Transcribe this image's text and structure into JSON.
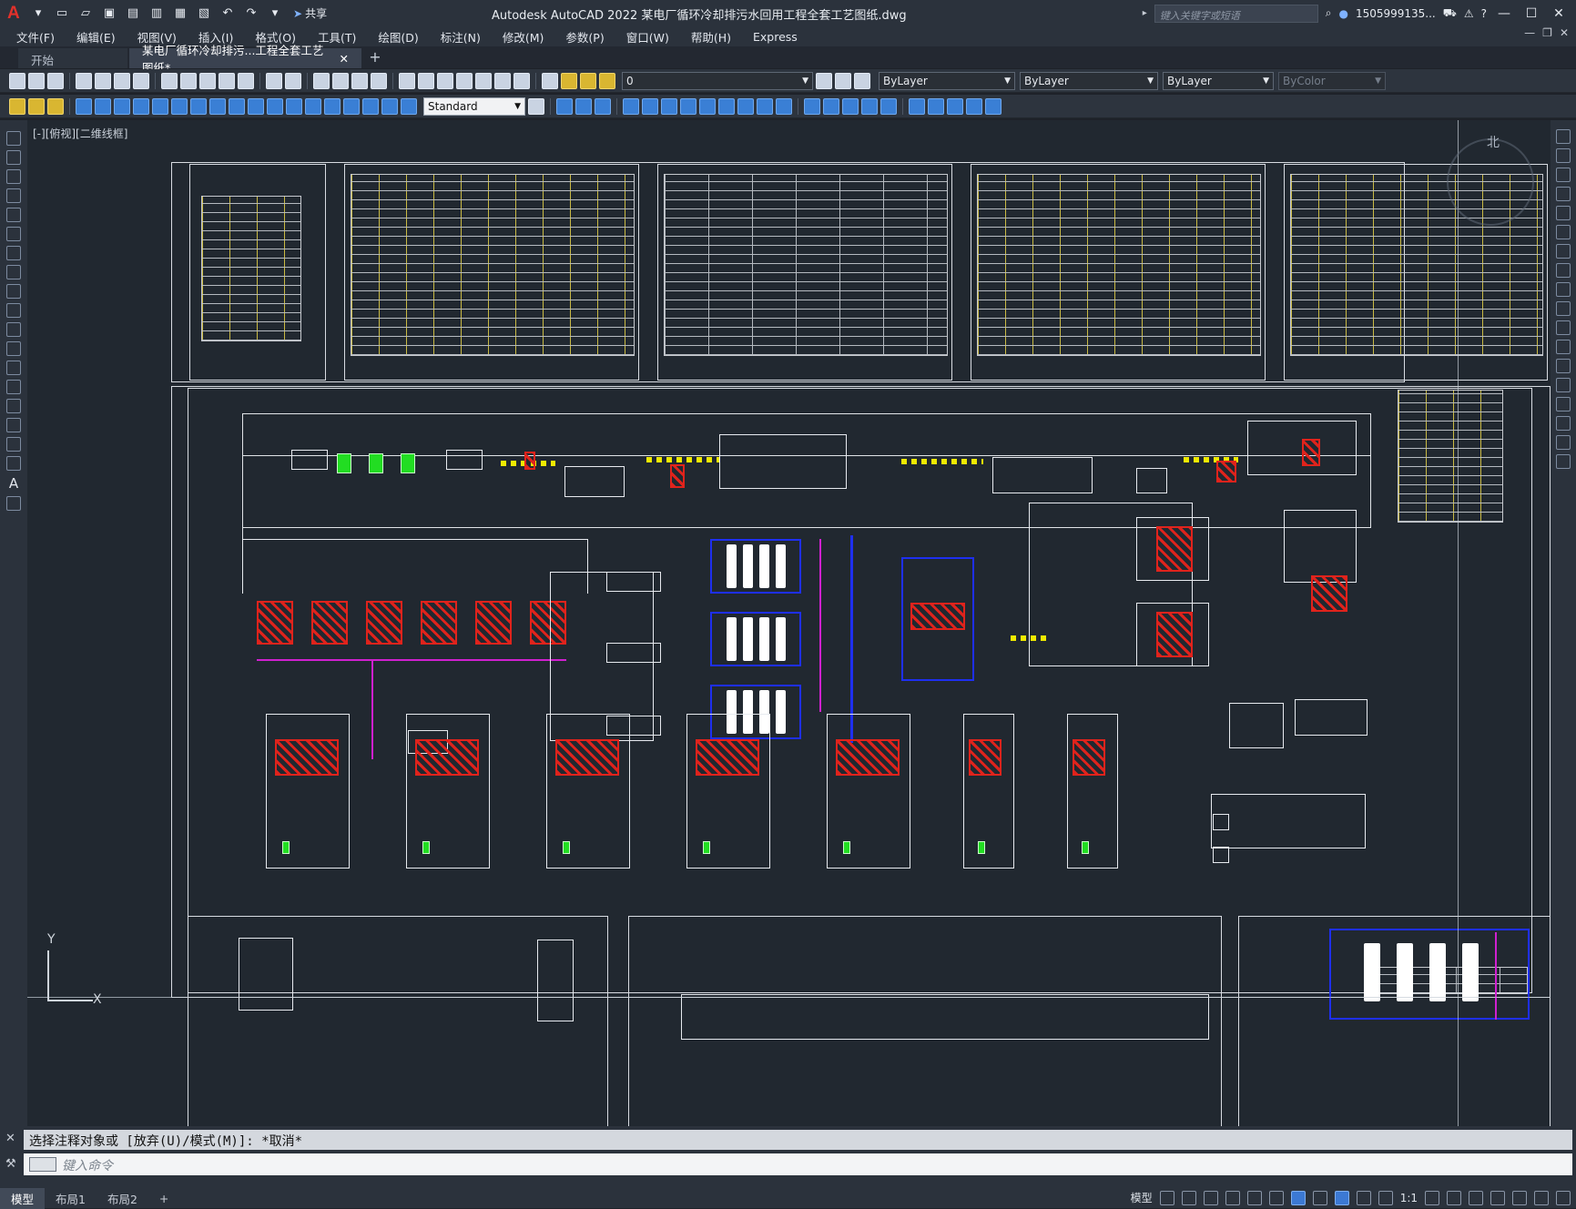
{
  "app": {
    "title": "Autodesk AutoCAD 2022    某电厂循环冷却排污水回用工程全套工艺图纸.dwg",
    "share_label": "共享",
    "search_placeholder": "键入关键字或短语",
    "user": "1505999135...",
    "logo_letter": "A"
  },
  "menu": {
    "items": [
      "文件(F)",
      "编辑(E)",
      "视图(V)",
      "插入(I)",
      "格式(O)",
      "工具(T)",
      "绘图(D)",
      "标注(N)",
      "修改(M)",
      "参数(P)",
      "窗口(W)",
      "帮助(H)",
      "Express"
    ]
  },
  "tabs": {
    "start": "开始",
    "doc": "某电厂循环冷却排污...工程全套工艺图纸*",
    "close": "✕",
    "add": "+"
  },
  "toolbar": {
    "layer_value": "0",
    "color_value": "ByLayer",
    "linetype_value": "ByLayer",
    "lineweight_value": "ByLayer",
    "plotstyle_value": "ByColor",
    "textstyle_value": "Standard"
  },
  "viewport": {
    "label": "[-][俯视][二维线框]",
    "compass_n": "北",
    "ucs_x": "X",
    "ucs_y": "Y"
  },
  "command": {
    "history": "选择注释对象或 [放弃(U)/模式(M)]: *取消*",
    "placeholder": "键入命令"
  },
  "status": {
    "tabs": [
      "模型",
      "布局1",
      "布局2"
    ],
    "model_label": "模型",
    "scale": "1:1"
  },
  "colors": {
    "accent_red": "#e0231c",
    "accent_yellow": "#f0ea00",
    "pipe_blue": "#1e2ff0",
    "pipe_magenta": "#d020d0",
    "green_equipment": "#22dd22"
  }
}
